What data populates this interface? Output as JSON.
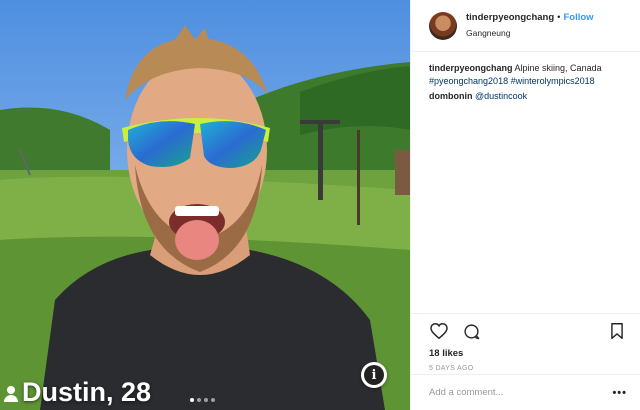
{
  "photo": {
    "name_age": "Dustin, 28",
    "person_icon": "person-icon",
    "info_icon": "info-icon",
    "pager_dots": 4,
    "active_dot": 0
  },
  "header": {
    "username": "tinderpyeongchang",
    "separator": "•",
    "follow_label": "Follow",
    "location": "Gangneung"
  },
  "comments": [
    {
      "user": "tinderpyeongchang",
      "text": "Alpine skiing, Canada",
      "tags": "#pyeongchang2018 #winterolympics2018"
    },
    {
      "user": "dombonin",
      "mention": "@dustincook"
    }
  ],
  "actions": {
    "like_icon": "heart-icon",
    "comment_icon": "comment-icon",
    "save_icon": "bookmark-icon",
    "likes": "18 likes",
    "timestamp": "5 DAYS AGO"
  },
  "composer": {
    "placeholder": "Add a comment...",
    "more_label": "•••"
  },
  "colors": {
    "link": "#3897f0",
    "hashtag": "#003569",
    "text": "#262626",
    "muted": "#999999"
  }
}
